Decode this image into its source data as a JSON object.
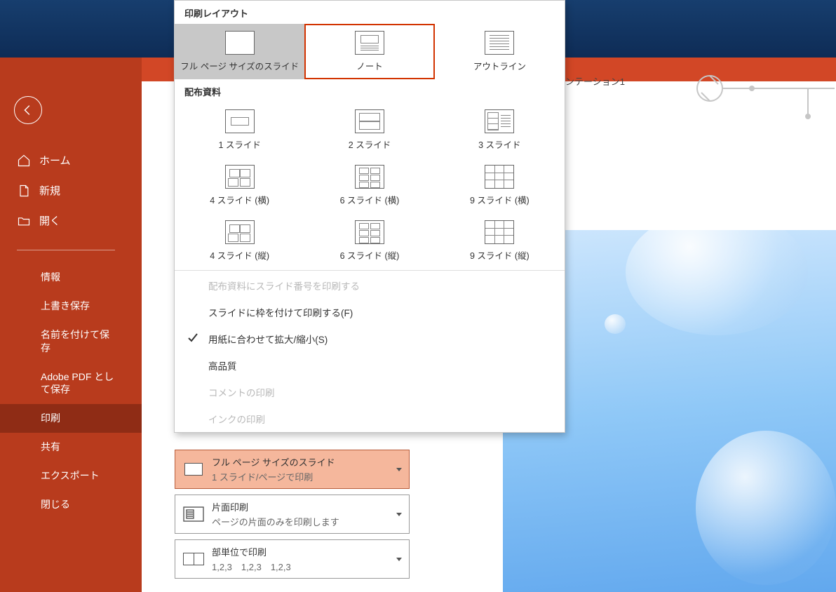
{
  "window": {
    "title_fragment": "ンテーション1"
  },
  "sidebar": {
    "primary": [
      {
        "label": "ホーム"
      },
      {
        "label": "新規"
      },
      {
        "label": "開く"
      }
    ],
    "secondary": [
      {
        "label": "情報"
      },
      {
        "label": "上書き保存"
      },
      {
        "label": "名前を付けて保存"
      },
      {
        "label": "Adobe PDF として保存"
      },
      {
        "label": "印刷",
        "active": true
      },
      {
        "label": "共有"
      },
      {
        "label": "エクスポート"
      },
      {
        "label": "閉じる"
      }
    ]
  },
  "settings": {
    "layout": {
      "line1": "フル ページ サイズのスライド",
      "line2": "1 スライド/ページで印刷"
    },
    "sides": {
      "line1": "片面印刷",
      "line2": "ページの片面のみを印刷します"
    },
    "collate": {
      "line1": "部単位で印刷",
      "line2": "1,2,3　1,2,3　1,2,3"
    }
  },
  "dropdown": {
    "section1_title": "印刷レイアウト",
    "section1_items": [
      {
        "label": "フル ページ サイズのスライド",
        "icon": "page",
        "selected": true
      },
      {
        "label": "ノート",
        "icon": "notes",
        "highlighted": true
      },
      {
        "label": "アウトライン",
        "icon": "outline"
      }
    ],
    "section2_title": "配布資料",
    "section2_rows": [
      [
        {
          "label": "1 スライド",
          "icon": "s1"
        },
        {
          "label": "2 スライド",
          "icon": "s2"
        },
        {
          "label": "3 スライド",
          "icon": "s3"
        }
      ],
      [
        {
          "label": "4 スライド (横)",
          "icon": "grid4"
        },
        {
          "label": "6 スライド (横)",
          "icon": "grid6"
        },
        {
          "label": "9 スライド (横)",
          "icon": "grid9"
        }
      ],
      [
        {
          "label": "4 スライド (縦)",
          "icon": "grid4"
        },
        {
          "label": "6 スライド (縦)",
          "icon": "grid6"
        },
        {
          "label": "9 スライド (縦)",
          "icon": "grid9"
        }
      ]
    ],
    "options": [
      {
        "label": "配布資料にスライド番号を印刷する",
        "disabled": true
      },
      {
        "label": "スライドに枠を付けて印刷する(F)"
      },
      {
        "label": "用紙に合わせて拡大/縮小(S)",
        "checked": true
      },
      {
        "label": "高品質"
      },
      {
        "label": "コメントの印刷",
        "disabled": true
      },
      {
        "label": "インクの印刷",
        "disabled": true
      }
    ]
  }
}
